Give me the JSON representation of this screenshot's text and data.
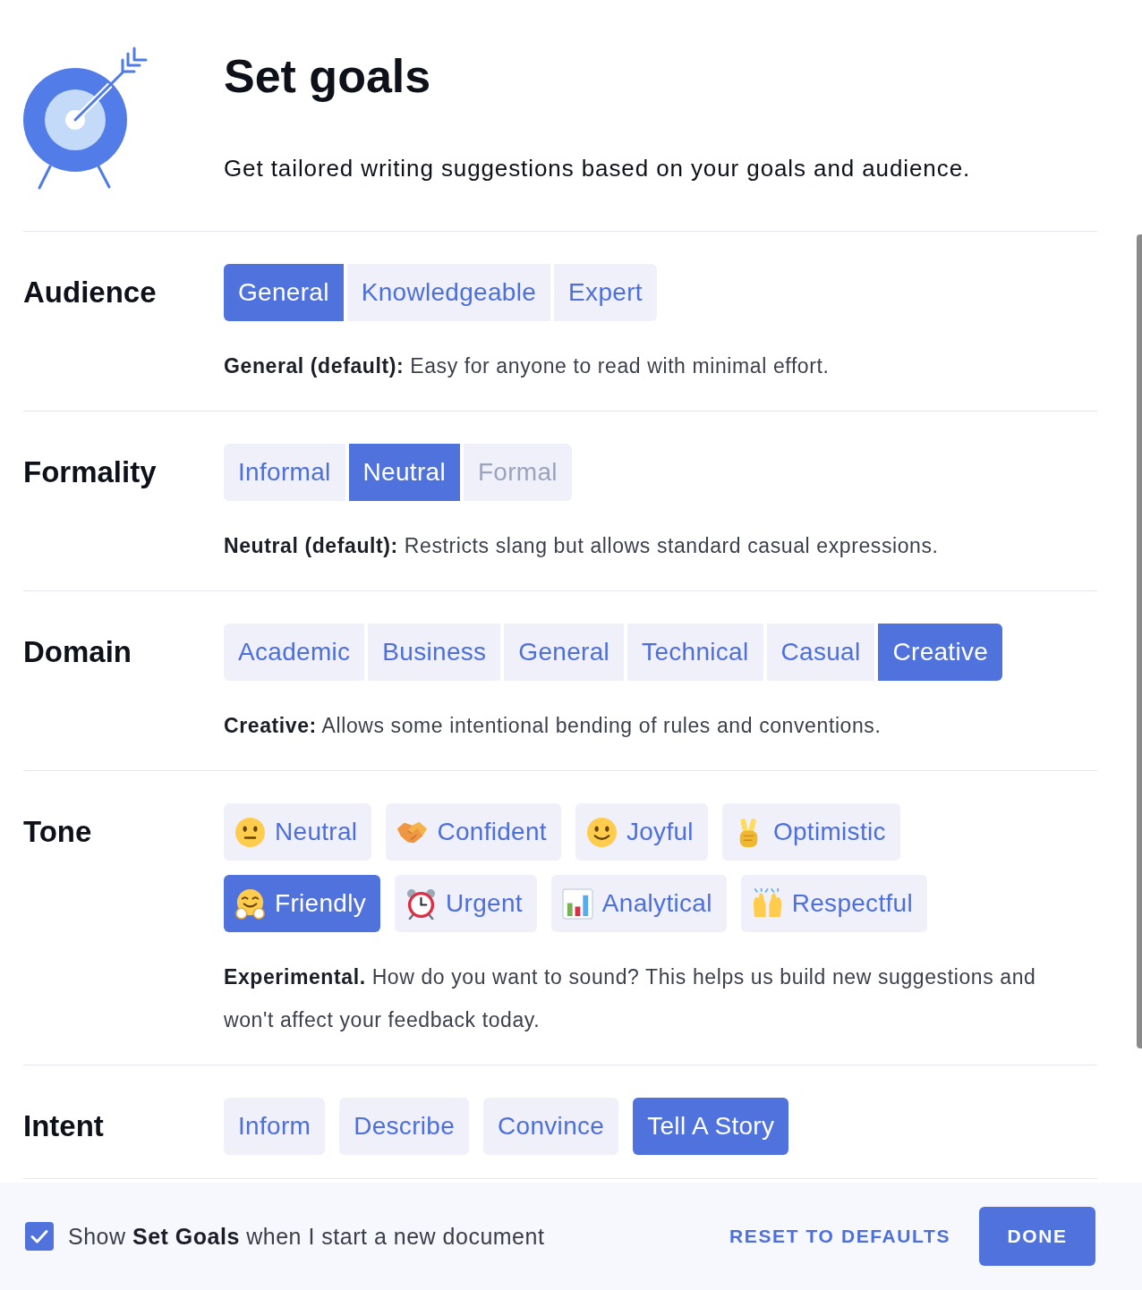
{
  "header": {
    "title": "Set goals",
    "subtitle": "Get tailored writing suggestions based on your goals and audience."
  },
  "sections": [
    {
      "label": "Audience",
      "kind": "segmented",
      "options": [
        {
          "label": "General",
          "selected": true
        },
        {
          "label": "Knowledgeable",
          "selected": false
        },
        {
          "label": "Expert",
          "selected": false
        }
      ],
      "description": "**General (default):** Easy for anyone to read with minimal effort."
    },
    {
      "label": "Formality",
      "kind": "segmented",
      "options": [
        {
          "label": "Informal",
          "selected": false,
          "disabled": false
        },
        {
          "label": "Neutral",
          "selected": true,
          "disabled": false
        },
        {
          "label": "Formal",
          "selected": false,
          "disabled": true
        }
      ],
      "description": "**Neutral (default):** Restricts slang but allows standard casual expressions."
    },
    {
      "label": "Domain",
      "kind": "segmented",
      "options": [
        {
          "label": "Academic",
          "selected": false
        },
        {
          "label": "Business",
          "selected": false
        },
        {
          "label": "General",
          "selected": false
        },
        {
          "label": "Technical",
          "selected": false
        },
        {
          "label": "Casual",
          "selected": false
        },
        {
          "label": "Creative",
          "selected": true
        }
      ],
      "description": "**Creative:** Allows some intentional bending of rules and conventions."
    },
    {
      "label": "Tone",
      "kind": "emoji-chips",
      "options": [
        {
          "label": "Neutral",
          "selected": false
        },
        {
          "label": "Confident",
          "selected": false
        },
        {
          "label": "Joyful",
          "selected": false
        },
        {
          "label": "Optimistic",
          "selected": false
        },
        {
          "label": "Friendly",
          "selected": true
        },
        {
          "label": "Urgent",
          "selected": false
        },
        {
          "label": "Analytical",
          "selected": false
        },
        {
          "label": "Respectful",
          "selected": false
        }
      ],
      "description": "**Experimental.** How do you want to sound? This helps us build new suggestions and won't affect your feedback today."
    },
    {
      "label": "Intent",
      "kind": "chips",
      "options": [
        {
          "label": "Inform",
          "selected": false
        },
        {
          "label": "Describe",
          "selected": false
        },
        {
          "label": "Convince",
          "selected": false
        },
        {
          "label": "Tell A Story",
          "selected": true
        }
      ]
    }
  ],
  "footer": {
    "checkbox": {
      "label": "Show **Set Goals** when I start a new document",
      "checked": true
    },
    "reset": "RESET TO DEFAULTS",
    "done": "DONE"
  }
}
